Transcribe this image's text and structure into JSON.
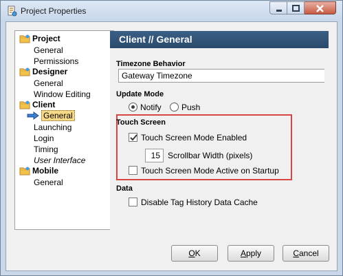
{
  "window": {
    "title": "Project Properties"
  },
  "tree": {
    "groups": [
      {
        "label": "Project",
        "items": [
          "General",
          "Permissions"
        ]
      },
      {
        "label": "Designer",
        "items": [
          "General",
          "Window Editing"
        ]
      },
      {
        "label": "Client",
        "items": [
          "General",
          "Launching",
          "Login",
          "Timing",
          "User Interface"
        ]
      },
      {
        "label": "Mobile",
        "items": [
          "General"
        ]
      }
    ],
    "selected": "Client / General"
  },
  "panel": {
    "header": "Client // General",
    "timezone": {
      "label": "Timezone Behavior",
      "value": "Gateway Timezone"
    },
    "update_mode": {
      "label": "Update Mode",
      "options": [
        "Notify",
        "Push"
      ],
      "selected": "Notify"
    },
    "touch_screen": {
      "label": "Touch Screen",
      "mode_enabled": {
        "label": "Touch Screen Mode Enabled",
        "checked": true
      },
      "scrollbar_width": {
        "label": "Scrollbar Width (pixels)",
        "value": "15"
      },
      "active_on_startup": {
        "label": "Touch Screen Mode Active on Startup",
        "checked": false
      }
    },
    "data": {
      "label": "Data",
      "disable_cache": {
        "label": "Disable Tag History Data Cache",
        "checked": false
      }
    }
  },
  "buttons": {
    "ok": {
      "mnemonic": "O",
      "rest": "K"
    },
    "apply": {
      "mnemonic": "A",
      "rest": "pply"
    },
    "cancel": {
      "mnemonic": "C",
      "rest": "ancel"
    }
  },
  "colors": {
    "header_bg": "#2f4f70",
    "highlight_border": "#d64541",
    "selection_bg": "#f7d987"
  }
}
